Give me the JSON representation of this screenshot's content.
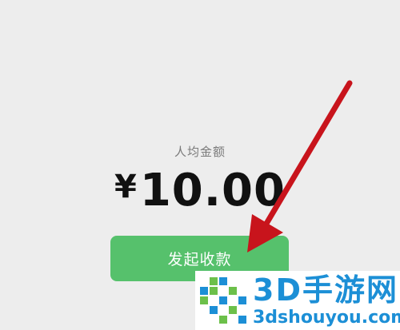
{
  "payment": {
    "label": "人均金额",
    "currency": "¥",
    "amount": "10.00",
    "button_label": "发起收款"
  },
  "annotation": {
    "arrow_color": "#c8141c"
  },
  "watermark": {
    "title": "3D手游网",
    "url": "3dshouyou.com"
  },
  "colors": {
    "background": "#ededed",
    "button": "#56c16c",
    "watermark_blue": "#1c8fd6",
    "watermark_green": "#6cc04a"
  }
}
